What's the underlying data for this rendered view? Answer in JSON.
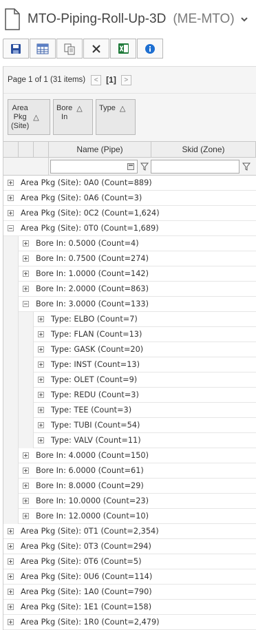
{
  "header": {
    "title": "MTO-Piping-Roll-Up-3D",
    "subtitle": "(ME-MTO)"
  },
  "toolbar": {
    "buttons": [
      {
        "name": "save-icon"
      },
      {
        "name": "table-icon"
      },
      {
        "name": "copy-icon"
      },
      {
        "name": "close-icon"
      },
      {
        "name": "excel-icon"
      },
      {
        "name": "info-icon"
      }
    ]
  },
  "pager": {
    "summary": "Page 1 of 1 (31 items)",
    "current": "[1]",
    "prev": "<",
    "next": ">"
  },
  "group_panel": {
    "chips": [
      {
        "label": "Area\nPkg\n(Site)",
        "sort": "△"
      },
      {
        "label": "Bore\nIn",
        "sort": "△"
      },
      {
        "label": "Type",
        "sort": "△"
      }
    ]
  },
  "columns": {
    "name": "Name (Pipe)",
    "skid": "Skid (Zone)"
  },
  "rows": [
    {
      "level": 0,
      "expanded": false,
      "text": "Area Pkg (Site): 0A0 (Count=889)"
    },
    {
      "level": 0,
      "expanded": false,
      "text": "Area Pkg (Site): 0A6 (Count=3)"
    },
    {
      "level": 0,
      "expanded": false,
      "text": "Area Pkg (Site): 0C2 (Count=1,624)"
    },
    {
      "level": 0,
      "expanded": true,
      "text": "Area Pkg (Site): 0T0 (Count=1,689)"
    },
    {
      "level": 1,
      "expanded": false,
      "text": "Bore In: 0.5000 (Count=4)"
    },
    {
      "level": 1,
      "expanded": false,
      "text": "Bore In: 0.7500 (Count=274)"
    },
    {
      "level": 1,
      "expanded": false,
      "text": "Bore In: 1.0000 (Count=142)"
    },
    {
      "level": 1,
      "expanded": false,
      "text": "Bore In: 2.0000 (Count=863)"
    },
    {
      "level": 1,
      "expanded": true,
      "text": "Bore In: 3.0000 (Count=133)"
    },
    {
      "level": 2,
      "expanded": false,
      "text": "Type: ELBO (Count=7)"
    },
    {
      "level": 2,
      "expanded": false,
      "text": "Type: FLAN (Count=13)"
    },
    {
      "level": 2,
      "expanded": false,
      "text": "Type: GASK (Count=20)"
    },
    {
      "level": 2,
      "expanded": false,
      "text": "Type: INST (Count=13)"
    },
    {
      "level": 2,
      "expanded": false,
      "text": "Type: OLET (Count=9)"
    },
    {
      "level": 2,
      "expanded": false,
      "text": "Type: REDU (Count=3)"
    },
    {
      "level": 2,
      "expanded": false,
      "text": "Type: TEE (Count=3)"
    },
    {
      "level": 2,
      "expanded": false,
      "text": "Type: TUBI (Count=54)"
    },
    {
      "level": 2,
      "expanded": false,
      "text": "Type: VALV (Count=11)"
    },
    {
      "level": 1,
      "expanded": false,
      "text": "Bore In: 4.0000 (Count=150)"
    },
    {
      "level": 1,
      "expanded": false,
      "text": "Bore In: 6.0000 (Count=61)"
    },
    {
      "level": 1,
      "expanded": false,
      "text": "Bore In: 8.0000 (Count=29)"
    },
    {
      "level": 1,
      "expanded": false,
      "text": "Bore In: 10.0000 (Count=23)"
    },
    {
      "level": 1,
      "expanded": false,
      "text": "Bore In: 12.0000 (Count=10)"
    },
    {
      "level": 0,
      "expanded": false,
      "text": "Area Pkg (Site): 0T1 (Count=2,354)"
    },
    {
      "level": 0,
      "expanded": false,
      "text": "Area Pkg (Site): 0T3 (Count=294)"
    },
    {
      "level": 0,
      "expanded": false,
      "text": "Area Pkg (Site): 0T6 (Count=5)"
    },
    {
      "level": 0,
      "expanded": false,
      "text": "Area Pkg (Site): 0U6 (Count=114)"
    },
    {
      "level": 0,
      "expanded": false,
      "text": "Area Pkg (Site): 1A0 (Count=790)"
    },
    {
      "level": 0,
      "expanded": false,
      "text": "Area Pkg (Site): 1E1 (Count=158)"
    },
    {
      "level": 0,
      "expanded": false,
      "text": "Area Pkg (Site): 1R0 (Count=2,479)"
    }
  ]
}
